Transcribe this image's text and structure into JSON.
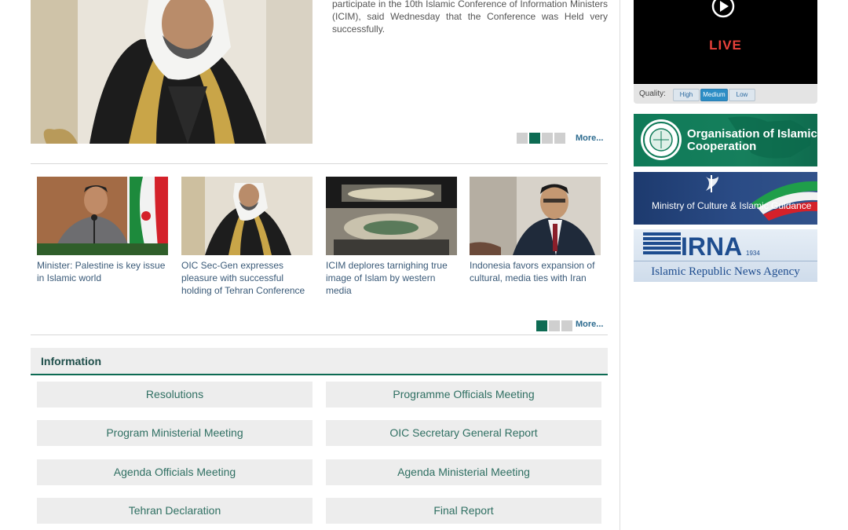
{
  "featured": {
    "text": "participate in the 10th Islamic Conference of Information Ministers (ICIM), said Wednesday that the Conference was Held very successfully.",
    "more": "More..."
  },
  "thumbs": [
    {
      "caption": "Minister: Palestine is key issue in Islamic world"
    },
    {
      "caption": "OIC Sec-Gen expresses pleasure with successful holding of Tehran Conference"
    },
    {
      "caption": "ICIM deplores tarnighing true image of Islam by western media"
    },
    {
      "caption": "Indonesia favors expansion of cultural, media ties with Iran"
    }
  ],
  "thumbs_more": "More...",
  "information": {
    "title": "Information",
    "buttons": [
      "Resolutions",
      "Programme Officials Meeting",
      "Program Ministerial Meeting",
      "OIC Secretary General Report",
      "Agenda Officials Meeting",
      "Agenda Ministerial Meeting",
      "Tehran Declaration",
      "Final Report"
    ]
  },
  "player": {
    "live": "LIVE",
    "quality_label": "Quality:",
    "quality_options": [
      "High",
      "Medium",
      "Low"
    ],
    "selected": "Medium"
  },
  "banners": {
    "oic": "Organisation of Islamic Cooperation",
    "mcig": "Ministry of Culture & Islamic Guidance",
    "irna_logo": "IRNA",
    "irna_year": "1934",
    "irna_name": "Islamic Republic News Agency"
  },
  "colors": {
    "accent": "#0d6b53",
    "link": "#2d6b8f",
    "live": "#e8413a"
  }
}
